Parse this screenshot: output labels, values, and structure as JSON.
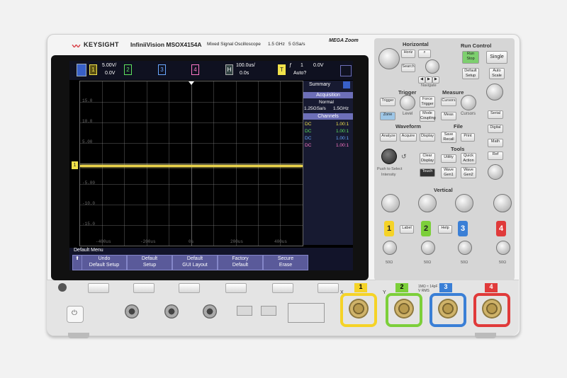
{
  "brand": {
    "logo_text": "KEYSIGHT",
    "model": "InfiniiVision MSOX4154A",
    "description": "Mixed Signal Oscilloscope",
    "bandwidth": "1.5 GHz",
    "sample_rate": "5 GSa/s",
    "megazoom": "MEGA Zoom"
  },
  "status": {
    "ch1_scale": "5.00V/",
    "ch1_offset": "0.0V",
    "ch1": "1",
    "ch2": "2",
    "ch3": "3",
    "ch4": "4",
    "h_label": "H",
    "timebase": "100.0us/",
    "delay": "0.0s",
    "trig_label": "T",
    "trig_source": "1",
    "trig_level": "0.0V",
    "trig_mode": "Auto?"
  },
  "plot": {
    "y_ticks": [
      "15.0",
      "10.0",
      "5.00",
      "-5.00",
      "-10.0",
      "-15.0"
    ],
    "x_ticks": [
      "-400us",
      "-200us",
      "0s",
      "200us",
      "400us"
    ],
    "ch1_marker": "1",
    "trace_color": "#e9d24a"
  },
  "sidepanel": {
    "title": "Summary",
    "acq_header": "Acquisition",
    "acq_mode": "Normal",
    "acq_rate": "1.25GSa/s",
    "acq_bw": "1.5GHz",
    "channels_header": "Channels",
    "channels": [
      {
        "coupling": "DC",
        "ratio": "1.00:1",
        "color": "#f1e24a"
      },
      {
        "coupling": "DC",
        "ratio": "1.00:1",
        "color": "#5ee35e"
      },
      {
        "coupling": "DC",
        "ratio": "1.00:1",
        "color": "#6aa8ff"
      },
      {
        "coupling": "DC",
        "ratio": "1.00:1",
        "color": "#ff77c8"
      }
    ]
  },
  "softmenu": {
    "title": "Default Menu",
    "keys": [
      {
        "l1": "Undo",
        "l2": "Default Setup"
      },
      {
        "l1": "Default",
        "l2": "Setup"
      },
      {
        "l1": "Default",
        "l2": "GUI Layout"
      },
      {
        "l1": "Factory",
        "l2": "Default"
      },
      {
        "l1": "Secure",
        "l2": "Erase"
      }
    ]
  },
  "panel": {
    "horizontal": "Horizontal",
    "run_control": "Run Control",
    "horiz_btn": "Horiz",
    "search_btn": "Search",
    "navigate": "Navigate",
    "run_stop": "Run Stop",
    "single": "Single",
    "default_setup": "Default Setup",
    "auto_scale": "Auto Scale",
    "trigger": "Trigger",
    "measure": "Measure",
    "trigger_btn": "Trigger",
    "force_trigger": "Force Trigger",
    "cursors_btn": "Cursors",
    "zone": "Zone",
    "level": "Level",
    "mode_coupling": "Mode Coupling",
    "meas": "Meas",
    "cursors": "Cursors",
    "waveform": "Waveform",
    "file": "File",
    "analyze": "Analyze",
    "acquire": "Acquire",
    "display": "Display",
    "save_recall": "Save Recall",
    "print": "Print",
    "tools": "Tools",
    "clear_display": "Clear Display",
    "utility": "Utility",
    "quick_action": "Quick Action",
    "touch": "Touch",
    "wave_gen1": "Wave Gen1",
    "wave_gen2": "Wave Gen2",
    "push_select": "Push to Select",
    "intensity": "Intensity",
    "vertical": "Vertical",
    "label": "Label",
    "help": "Help",
    "serial": "Serial",
    "digital": "Digital",
    "math": "Math",
    "ref": "Ref",
    "ohm_labels": [
      "50Ω",
      "50Ω",
      "50Ω",
      "50Ω"
    ]
  },
  "inputs": {
    "ch1": "1",
    "ch2": "2",
    "ch3": "3",
    "ch4": "4",
    "x_label": "X",
    "y_label": "Y",
    "rating": "1MΩ ≈ 14pF 135 V RMS",
    "ch1_color": "#f5d327",
    "ch2_color": "#7ccf3a",
    "ch3_color": "#3a7fd6",
    "ch4_color": "#e03a3a"
  }
}
